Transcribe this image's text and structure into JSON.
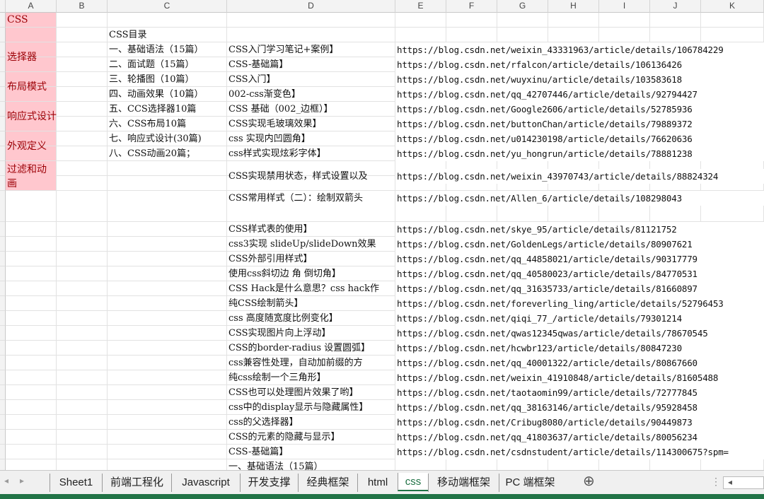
{
  "columns": [
    "A",
    "B",
    "C",
    "D",
    "E",
    "F",
    "G",
    "H",
    "I",
    "J",
    "K"
  ],
  "col_a": [
    "CSS",
    "选择器",
    "布局模式",
    "响应式设计",
    "外观定义",
    "过滤和动画"
  ],
  "col_c": [
    "CSS目录",
    "一、基础语法（15篇）",
    "二、面试题（15篇）",
    "三、轮播图（10篇）",
    "四、动画效果（10篇）",
    "五、CCS选择器10篇",
    "六、CSS布局10篇",
    "七、响应式设计(30篇)",
    "八、CSS动画20篇；"
  ],
  "col_d": [
    "CSS入门学习笔记+案例】",
    "CSS-基础篇】",
    "CSS入门】",
    "002-css渐变色】",
    "CSS 基础（002_边框）】",
    "CSS实现毛玻璃效果】",
    "css 实现内凹圆角】",
    "css样式实现炫彩字体】",
    "CSS实现禁用状态，样式设置以及",
    "CSS常用样式（二）：绘制双箭头",
    "CSS样式表的使用】",
    "css3实现 slideUp/slideDown效果",
    "CSS外部引用样式】",
    "使用css斜切边 角 倒切角】",
    "CSS Hack是什么意思？css hack作",
    "纯CSS绘制箭头】",
    "css 高度随宽度比例变化】",
    "CSS实现图片向上浮动】",
    "CSS的border-radius 设置圆弧】",
    "css兼容性处理，自动加前缀的方",
    "纯css绘制一个三角形】",
    "CSS也可以处理图片效果了哟】",
    "css中的display显示与隐藏属性】",
    "css的父选择器】",
    "CSS的元素的隐藏与显示】",
    "CSS-基础篇】",
    "一、基础语法（15篇）"
  ],
  "col_e": [
    "https://blog.csdn.net/weixin_43331963/article/details/106784229",
    "https://blog.csdn.net/rfalcon/article/details/106136426",
    "https://blog.csdn.net/wuyxinu/article/details/103583618",
    "https://blog.csdn.net/qq_42707446/article/details/92794427",
    "https://blog.csdn.net/Google2606/article/details/52785936",
    "https://blog.csdn.net/buttonChan/article/details/79889372",
    "https://blog.csdn.net/u014230198/article/details/76620636",
    "https://blog.csdn.net/yu_hongrun/article/details/78881238",
    "https://blog.csdn.net/weixin_43970743/article/details/88824324",
    "https://blog.csdn.net/Allen_6/article/details/108298043",
    "https://blog.csdn.net/skye_95/article/details/81121752",
    "https://blog.csdn.net/GoldenLegs/article/details/80907621",
    "https://blog.csdn.net/qq_44858021/article/details/90317779",
    "https://blog.csdn.net/qq_40580023/article/details/84770531",
    "https://blog.csdn.net/qq_31635733/article/details/81660897",
    "https://blog.csdn.net/foreverling_ling/article/details/52796453",
    "https://blog.csdn.net/qiqi_77_/article/details/79301214",
    "https://blog.csdn.net/qwas12345qwas/article/details/78670545",
    "https://blog.csdn.net/hcwbr123/article/details/80847230",
    "https://blog.csdn.net/qq_40001322/article/details/80867660",
    "https://blog.csdn.net/weixin_41910848/article/details/81605488",
    "https://blog.csdn.net/taotaomin99/article/details/72777845",
    "https://blog.csdn.net/qq_38163146/article/details/95928458",
    "https://blog.csdn.net/Cribug8080/article/details/90449873",
    "https://blog.csdn.net/qq_41803637/article/details/80056234",
    "https://blog.csdn.net/csdnstudent/article/details/114300675?spm=",
    ""
  ],
  "tabs": [
    "Sheet1",
    "前端工程化",
    "Javascript",
    "开发支撑",
    "经典框架",
    "html",
    "css",
    "移动端框架",
    "PC 端框架"
  ],
  "active_tab": "css",
  "colors": {
    "pink_fill": "#ffc7ce",
    "pink_text": "#9c0006",
    "excel_green": "#217346"
  },
  "icons": {
    "prev_sheet": "◂",
    "next_sheet": "▸",
    "add_sheet": "⊕",
    "more": "⋮",
    "scroll_left": "◂"
  }
}
